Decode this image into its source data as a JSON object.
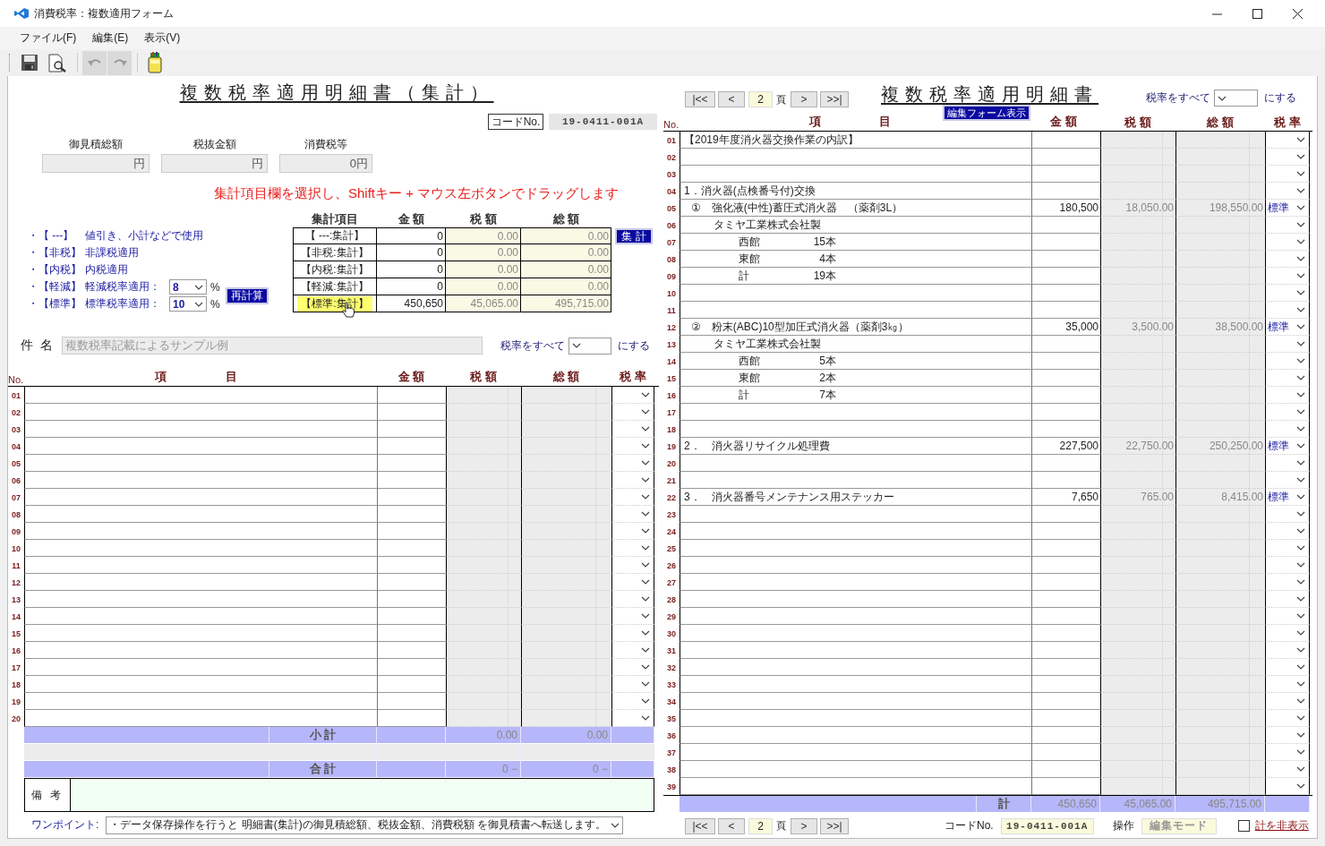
{
  "window": {
    "title": "消費税率：複数適用フォーム"
  },
  "menu": [
    {
      "label": "ファイル(F)"
    },
    {
      "label": "編集(E)"
    },
    {
      "label": "表示(V)"
    }
  ],
  "toolbar": [
    {
      "kind": "save",
      "disabled": false
    },
    {
      "kind": "preview",
      "disabled": false
    },
    {
      "kind": "undo",
      "disabled": true
    },
    {
      "kind": "redo",
      "disabled": true
    },
    {
      "kind": "jar",
      "disabled": false
    }
  ],
  "summary_form": {
    "title": "複数税率適用明細書（集計）",
    "code": {
      "label": "コードNo.",
      "value": "19-0411-001A"
    },
    "totals": [
      {
        "label": "御見積総額",
        "value": "円"
      },
      {
        "label": "税抜金額",
        "value": "円"
      },
      {
        "label": "消費税等",
        "value": "0円"
      }
    ],
    "instruction": "集計項目欄を選択し、Shiftキー + マウス左ボタンでドラッグします",
    "legend": [
      {
        "kind": "text",
        "key": "・【 ---】",
        "description": "値引き、小計などで使用"
      },
      {
        "kind": "text",
        "key": "・【非税】",
        "description": "非課税適用"
      },
      {
        "kind": "text",
        "key": "・【内税】",
        "description": "内税適用"
      },
      {
        "kind": "rate",
        "key": "・【軽減】",
        "description": "軽減税率適用：",
        "value": "8",
        "unit": "%"
      },
      {
        "kind": "rate",
        "key": "・【標準】",
        "description": "標準税率適用：",
        "value": "10",
        "unit": "%"
      }
    ],
    "recalc_button": "再計算",
    "aggregate": {
      "columns": [
        "集計項目",
        "金 額",
        "税 額",
        "総 額"
      ],
      "rows": [
        {
          "label": "【 ---:集計】",
          "amount": "0",
          "tax": "0.00",
          "total": "0.00",
          "selected": false
        },
        {
          "label": "【非税:集計】",
          "amount": "0",
          "tax": "0.00",
          "total": "0.00",
          "selected": false
        },
        {
          "label": "【内税:集計】",
          "amount": "0",
          "tax": "0.00",
          "total": "0.00",
          "selected": false
        },
        {
          "label": "【軽減:集計】",
          "amount": "0",
          "tax": "0.00",
          "total": "0.00",
          "selected": false
        },
        {
          "label": "【標準:集計】",
          "amount": "450,650",
          "tax": "45,065.00",
          "total": "495,715.00",
          "selected": true
        }
      ],
      "button": "集 計"
    },
    "subject": {
      "label": "件 名",
      "value": "複数税率記載によるサンプル例",
      "disabled": true
    },
    "rate_all": {
      "label": "税率をすべて",
      "suffix": "にする"
    },
    "grid": {
      "columns": {
        "no": "No.",
        "item": [
          "項",
          "目"
        ],
        "amount": "金 額",
        "tax": "税 額",
        "total": "総 額",
        "rate": "税 率"
      },
      "rows": [
        {
          "no": "01"
        },
        {
          "no": "02"
        },
        {
          "no": "03"
        },
        {
          "no": "04"
        },
        {
          "no": "05"
        },
        {
          "no": "06"
        },
        {
          "no": "07"
        },
        {
          "no": "08"
        },
        {
          "no": "09"
        },
        {
          "no": "10"
        },
        {
          "no": "11"
        },
        {
          "no": "12"
        },
        {
          "no": "13"
        },
        {
          "no": "14"
        },
        {
          "no": "15"
        },
        {
          "no": "16"
        },
        {
          "no": "17"
        },
        {
          "no": "18"
        },
        {
          "no": "19"
        },
        {
          "no": "20"
        }
      ],
      "subtotal": {
        "label": "小 計",
        "tax": "0.00",
        "total": "0.00"
      },
      "grand_total": {
        "label": "合 計",
        "tax": "0 −",
        "total": "0 −"
      }
    },
    "remarks": {
      "label": "備 考"
    },
    "one_point": {
      "label": "ワンポイント:",
      "value": "・データ保存操作を行うと 明細書(集計)の御見積総額、税抜金額、消費税額 を御見積書へ転送します。"
    }
  },
  "detail_form": {
    "pager": {
      "buttons": [
        "|<<",
        "<",
        ">",
        ">>|"
      ],
      "page": "2",
      "unit": "頁"
    },
    "title": "複数税率適用明細書",
    "edit_button": "編集フォーム表示",
    "rate_all": {
      "label": "税率をすべて",
      "suffix": "にする"
    },
    "grid": {
      "columns": {
        "no": "No.",
        "item": [
          "項",
          "目"
        ],
        "amount": "金 額",
        "tax": "税 額",
        "total": "総 額",
        "rate": "税 率"
      },
      "rows": [
        {
          "no": "01",
          "kind": "heading",
          "item": "【2019年度消火器交換作業の内訳】"
        },
        {
          "no": "02",
          "kind": "blank"
        },
        {
          "no": "03",
          "kind": "blank"
        },
        {
          "no": "04",
          "kind": "heading",
          "item": "1．消火器(点検番号付)交換"
        },
        {
          "no": "05",
          "kind": "item",
          "item": "①　強化液(中性)蓄圧式消火器　（薬剤3L）",
          "amount": "180,500",
          "tax": "18,050.00",
          "total": "198,550.00",
          "rate": "標準"
        },
        {
          "no": "06",
          "kind": "maker",
          "item": "タミヤ工業株式会社製"
        },
        {
          "no": "07",
          "kind": "detail",
          "item": "西館",
          "count": "15本"
        },
        {
          "no": "08",
          "kind": "detail",
          "item": "東館",
          "count": "4本"
        },
        {
          "no": "09",
          "kind": "detail",
          "item": "計",
          "count": "19本"
        },
        {
          "no": "10",
          "kind": "blank"
        },
        {
          "no": "11",
          "kind": "blank"
        },
        {
          "no": "12",
          "kind": "item",
          "item": "②　粉末(ABC)10型加圧式消火器（薬剤3㎏）",
          "amount": "35,000",
          "tax": "3,500.00",
          "total": "38,500.00",
          "rate": "標準"
        },
        {
          "no": "13",
          "kind": "maker",
          "item": "タミヤ工業株式会社製"
        },
        {
          "no": "14",
          "kind": "detail",
          "item": "西館",
          "count": "5本"
        },
        {
          "no": "15",
          "kind": "detail",
          "item": "東館",
          "count": "2本"
        },
        {
          "no": "16",
          "kind": "detail",
          "item": "計",
          "count": "7本"
        },
        {
          "no": "17",
          "kind": "blank"
        },
        {
          "no": "18",
          "kind": "blank"
        },
        {
          "no": "19",
          "kind": "heading",
          "item": "2．　消火器リサイクル処理費",
          "amount": "227,500",
          "tax": "22,750.00",
          "total": "250,250.00",
          "rate": "標準"
        },
        {
          "no": "20",
          "kind": "blank"
        },
        {
          "no": "21",
          "kind": "blank"
        },
        {
          "no": "22",
          "kind": "heading",
          "item": "3．　消火器番号メンテナンス用ステッカー",
          "amount": "7,650",
          "tax": "765.00",
          "total": "8,415.00",
          "rate": "標準"
        },
        {
          "no": "23",
          "kind": "blank"
        },
        {
          "no": "24",
          "kind": "blank"
        },
        {
          "no": "25",
          "kind": "blank"
        },
        {
          "no": "26",
          "kind": "blank"
        },
        {
          "no": "27",
          "kind": "blank"
        },
        {
          "no": "28",
          "kind": "blank"
        },
        {
          "no": "29",
          "kind": "blank"
        },
        {
          "no": "30",
          "kind": "blank"
        },
        {
          "no": "31",
          "kind": "blank"
        },
        {
          "no": "32",
          "kind": "blank"
        },
        {
          "no": "33",
          "kind": "blank"
        },
        {
          "no": "34",
          "kind": "blank"
        },
        {
          "no": "35",
          "kind": "blank"
        },
        {
          "no": "36",
          "kind": "blank"
        },
        {
          "no": "37",
          "kind": "blank"
        },
        {
          "no": "38",
          "kind": "blank"
        },
        {
          "no": "39",
          "kind": "blank"
        }
      ],
      "total": {
        "label": "計",
        "amount": "450,650",
        "tax": "45,065.00",
        "total": "495,715.00"
      }
    },
    "footer": {
      "pager": {
        "buttons": [
          "|<<",
          "<",
          ">",
          ">>|"
        ],
        "page": "2",
        "unit": "頁"
      },
      "code": {
        "label": "コードNo.",
        "value": "19-0411-001A"
      },
      "operation": {
        "label": "操作",
        "value": "編集モード",
        "disabled": true
      },
      "hide_total": {
        "label": "計を非表示",
        "checked": false
      }
    }
  }
}
